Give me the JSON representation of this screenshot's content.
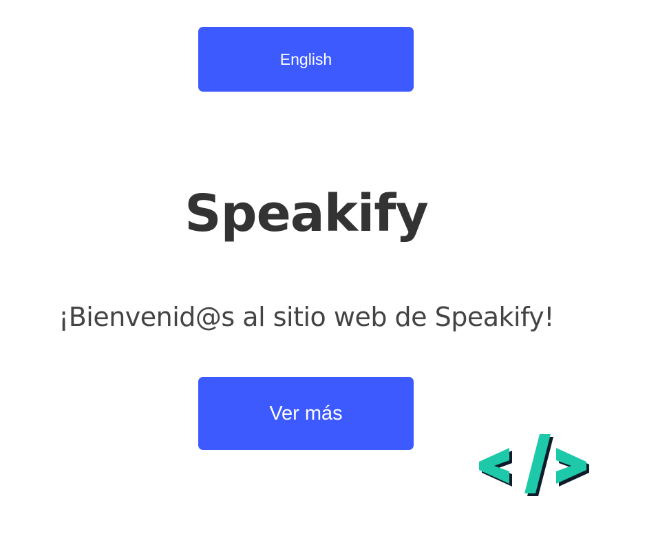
{
  "language_button": {
    "label": "English"
  },
  "header": {
    "title": "Speakify"
  },
  "main": {
    "welcome": "¡Bienvenid@s al sitio web de Speakify!",
    "more_button_label": "Ver más"
  },
  "logo": {
    "icon": "code-brackets-icon"
  },
  "colors": {
    "button_bg": "#3d5afe",
    "title_text": "#333333",
    "body_text": "#444444",
    "logo_fill": "#1ec9a9",
    "logo_shadow": "#0d1b2a"
  }
}
